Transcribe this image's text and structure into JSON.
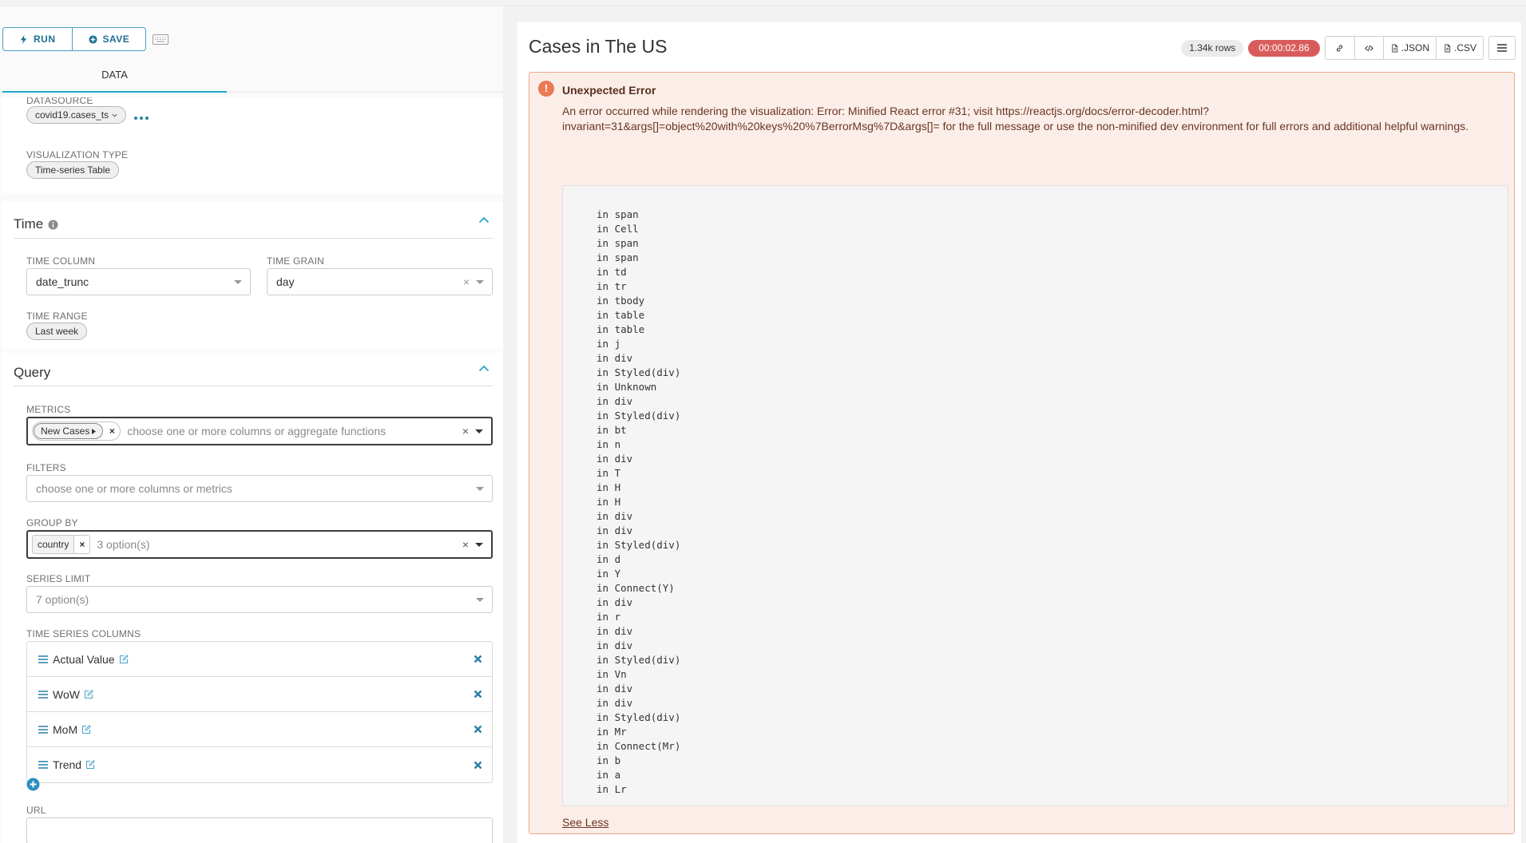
{
  "toolbar": {
    "run_label": "RUN",
    "save_label": "SAVE"
  },
  "tabs": {
    "data_label": "DATA"
  },
  "datasource": {
    "label": "DATASOURCE",
    "value": "covid19.cases_ts"
  },
  "viz_type": {
    "label": "VISUALIZATION TYPE",
    "value": "Time-series Table"
  },
  "time_section": {
    "title": "Time",
    "time_column": {
      "label": "TIME COLUMN",
      "value": "date_trunc"
    },
    "time_grain": {
      "label": "TIME GRAIN",
      "value": "day"
    },
    "time_range": {
      "label": "TIME RANGE",
      "value": "Last week"
    }
  },
  "query_section": {
    "title": "Query",
    "metrics": {
      "label": "METRICS",
      "tag": "New Cases",
      "placeholder": "choose one or more columns or aggregate functions"
    },
    "filters": {
      "label": "FILTERS",
      "placeholder": "choose one or more columns or metrics"
    },
    "group_by": {
      "label": "GROUP BY",
      "tag": "country",
      "hint": "3 option(s)"
    },
    "series_limit": {
      "label": "SERIES LIMIT",
      "placeholder": "7 option(s)"
    },
    "time_series_columns": {
      "label": "TIME SERIES COLUMNS",
      "items": [
        "Actual Value",
        "WoW",
        "MoM",
        "Trend"
      ]
    },
    "url": {
      "label": "URL"
    }
  },
  "chart": {
    "title": "Cases in The US",
    "row_count": "1.34k rows",
    "elapsed": "00:00:02.86",
    "json_label": ".JSON",
    "csv_label": ".CSV"
  },
  "error": {
    "title": "Unexpected Error",
    "message": "An error occurred while rendering the visualization: Error: Minified React error #31; visit https://reactjs.org/docs/error-decoder.html?invariant=31&args[]=object%20with%20keys%20%7BerrorMsg%7D&args[]= for the full message or use the non-minified dev environment for full errors and additional helpful warnings.",
    "stack": [
      "in span",
      "in Cell",
      "in span",
      "in span",
      "in td",
      "in tr",
      "in tbody",
      "in table",
      "in table",
      "in j",
      "in div",
      "in Styled(div)",
      "in Unknown",
      "in div",
      "in Styled(div)",
      "in bt",
      "in n",
      "in div",
      "in T",
      "in H",
      "in H",
      "in div",
      "in div",
      "in Styled(div)",
      "in d",
      "in Y",
      "in Connect(Y)",
      "in div",
      "in r",
      "in div",
      "in div",
      "in Styled(div)",
      "in Vn",
      "in div",
      "in div",
      "in Styled(div)",
      "in Mr",
      "in Connect(Mr)",
      "in b",
      "in a",
      "in Lr"
    ],
    "see_less": "See Less"
  },
  "colors": {
    "accent": "#20a7c9",
    "link": "#1d6f94",
    "error_bg": "#fbeee9",
    "error_border": "#f0a888",
    "timer_bg": "#d95c5c"
  }
}
